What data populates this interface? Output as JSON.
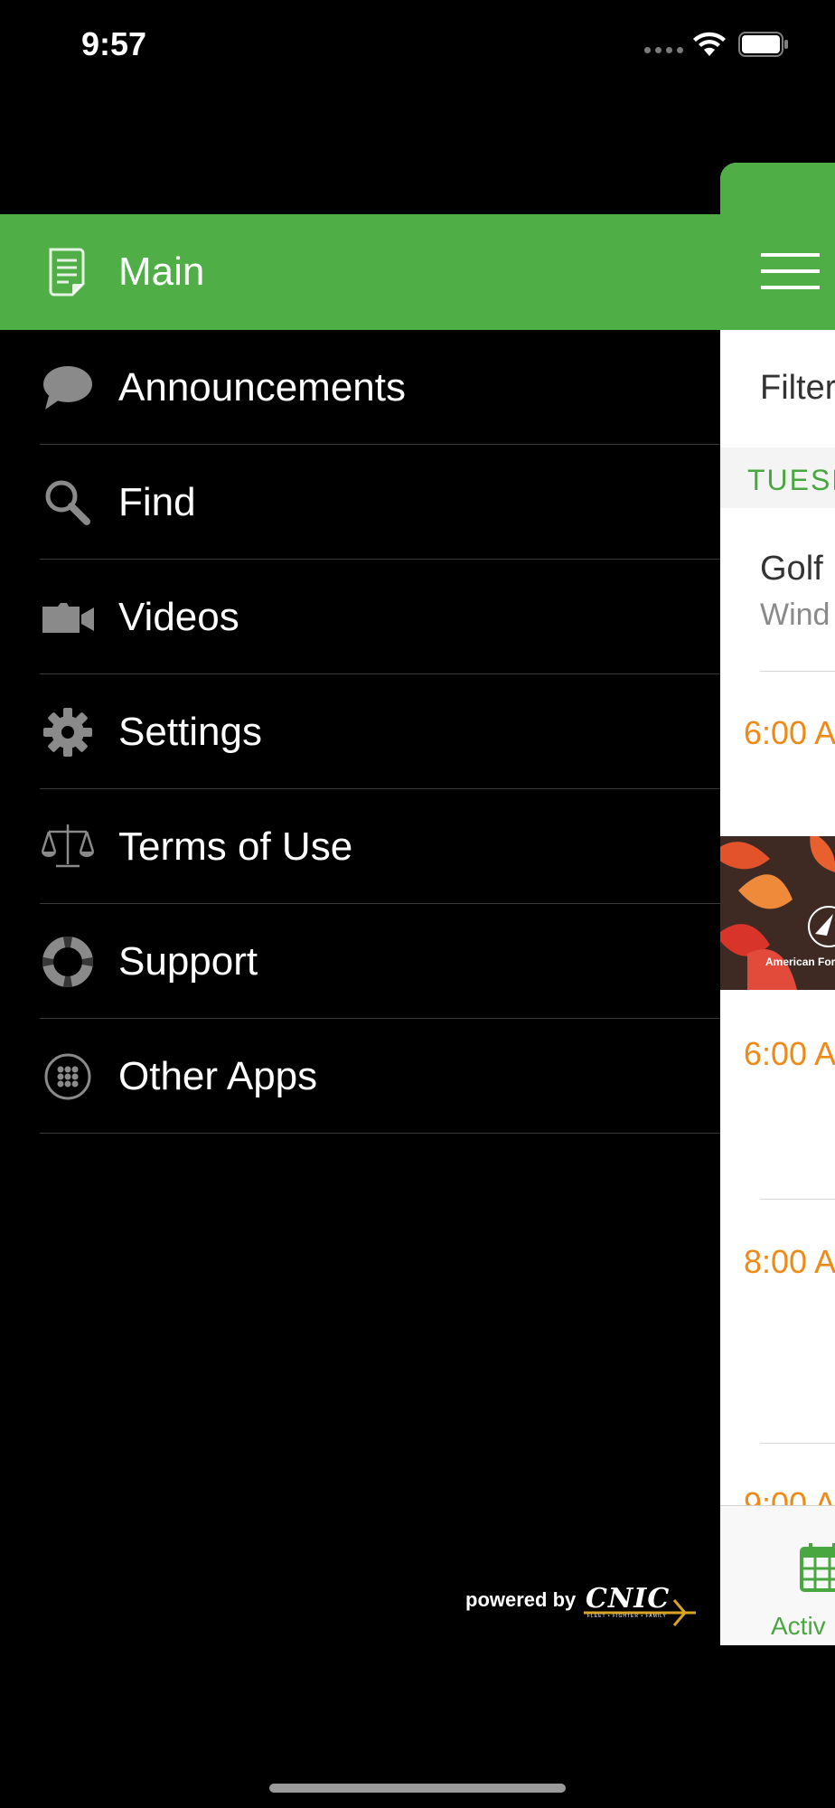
{
  "status_bar": {
    "time": "9:57"
  },
  "menu": {
    "items": [
      {
        "label": "Main",
        "icon": "document-icon",
        "selected": true
      },
      {
        "label": "Announcements",
        "icon": "speech-bubble-icon"
      },
      {
        "label": "Find",
        "icon": "magnifier-icon"
      },
      {
        "label": "Videos",
        "icon": "video-camera-icon"
      },
      {
        "label": "Settings",
        "icon": "gear-icon"
      },
      {
        "label": "Terms of Use",
        "icon": "scales-icon"
      },
      {
        "label": "Support",
        "icon": "lifebuoy-icon"
      },
      {
        "label": "Other Apps",
        "icon": "app-grid-icon"
      }
    ],
    "accent_color": "#50ae47"
  },
  "footer": {
    "powered_by": "powered by",
    "brand": "CNIC",
    "brand_tagline": "FLEET • FIGHTER • FAMILY"
  },
  "background_panel": {
    "filter_label": "Filter",
    "day_label": "TUESD",
    "event_title": "Golf",
    "event_subtitle": "Wind",
    "times": [
      "6:00 A",
      "6:00 A",
      "8:00 A",
      "9:00 A"
    ],
    "promo_text": "American For",
    "tab_label": "Activ",
    "time_color": "#ef8a19"
  }
}
